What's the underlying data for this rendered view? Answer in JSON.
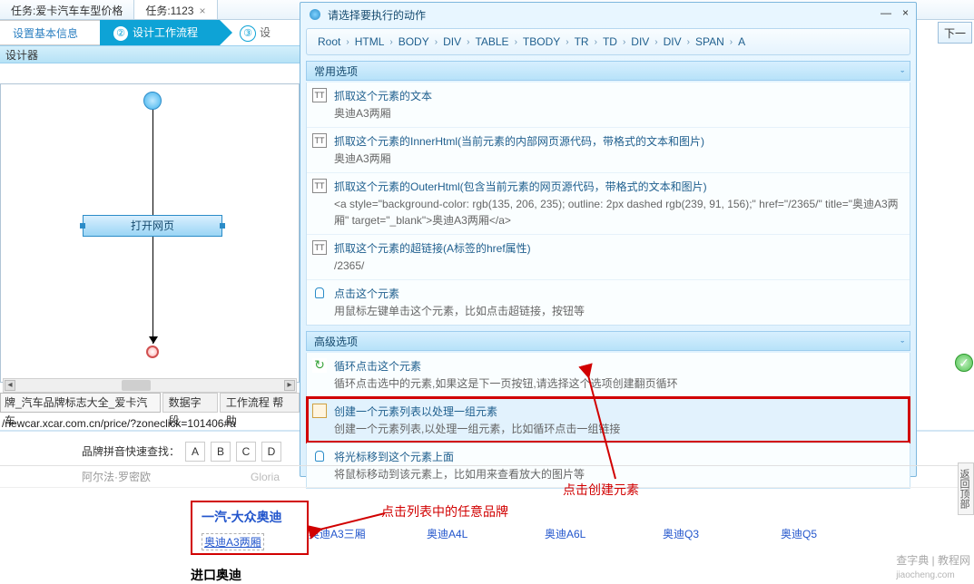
{
  "tabs": {
    "tab1": "任务:爱卡汽车车型价格",
    "tab2": "任务:1123",
    "close": "×"
  },
  "steps": {
    "s1": "设置基本信息",
    "s2_num": "②",
    "s2": "设计工作流程",
    "s3_num": "③",
    "s3": "设",
    "next": "下一"
  },
  "designer": {
    "label": "设计器"
  },
  "flow": {
    "open_webpage": "打开网页"
  },
  "srcrow": {
    "label": "牌_汽车品牌标志大全_爱卡汽车",
    "tab1": "数据字段",
    "tab2": "工作流程 帮助"
  },
  "url": "/newcar.xcar.com.cn/price/?zoneclick=101406#a",
  "popup": {
    "title": "请选择要执行的动作",
    "min": "—",
    "close": "×",
    "breadcrumb": [
      "Root",
      "HTML",
      "BODY",
      "DIV",
      "TABLE",
      "TBODY",
      "TR",
      "TD",
      "DIV",
      "DIV",
      "SPAN",
      "A"
    ],
    "sep": "›",
    "common_header": "常用选项",
    "advanced_header": "高级选项",
    "chev": "ˇ",
    "options_common": [
      {
        "ic": "TT",
        "title": "抓取这个元素的文本",
        "desc": "奥迪A3两厢"
      },
      {
        "ic": "TT",
        "title": "抓取这个元素的InnerHtml(当前元素的内部网页源代码，带格式的文本和图片)",
        "desc": "奥迪A3两厢"
      },
      {
        "ic": "TT",
        "title": "抓取这个元素的OuterHtml(包含当前元素的网页源代码，带格式的文本和图片)",
        "desc": "<a style=\"background-color: rgb(135, 206, 235); outline: 2px dashed rgb(239, 91, 156);\" href=\"/2365/\" title=\"奥迪A3两厢\" target=\"_blank\">奥迪A3两厢</a>"
      },
      {
        "ic": "TT",
        "title": "抓取这个元素的超链接(A标签的href属性)",
        "desc": "/2365/"
      },
      {
        "ic": "click",
        "title": "点击这个元素",
        "desc": "用鼠标左键单击这个元素，比如点击超链接，按钮等"
      }
    ],
    "options_adv": [
      {
        "ic": "loop",
        "title": "循环点击这个元素",
        "desc": "循环点击选中的元素,如果这是下一页按钮,请选择这个选项创建翻页循环"
      },
      {
        "ic": "doc",
        "title": "创建一个元素列表以处理一组元素",
        "desc": "创建一个元素列表,以处理一组元素，比如循环点击一组链接",
        "hl": true
      },
      {
        "ic": "click",
        "title": "将光标移到这个元素上面",
        "desc": "将鼠标移动到该元素上，比如用来查看放大的图片等"
      }
    ]
  },
  "brand": {
    "search_label": "品牌拼音快速查找：",
    "letters": [
      "A",
      "B",
      "C",
      "D"
    ],
    "row1_left": "阿尔法·罗密欧",
    "row1_right": "Gloria",
    "group_title": "一汽-大众奥迪",
    "group_model": "奥迪A3两厢",
    "group2_title": "进口奥迪",
    "models": [
      "奥迪A3三厢",
      "奥迪A4L",
      "奥迪A6L",
      "奥迪Q3",
      "奥迪Q5"
    ]
  },
  "anno": {
    "click_list": "点击列表中的任意品牌",
    "click_create": "点击创建元素"
  },
  "side": {
    "label": "返回顶部"
  },
  "wm": {
    "main": "查字典 | 教程网",
    "sub": "jiaocheng.com"
  },
  "ok": "✓"
}
